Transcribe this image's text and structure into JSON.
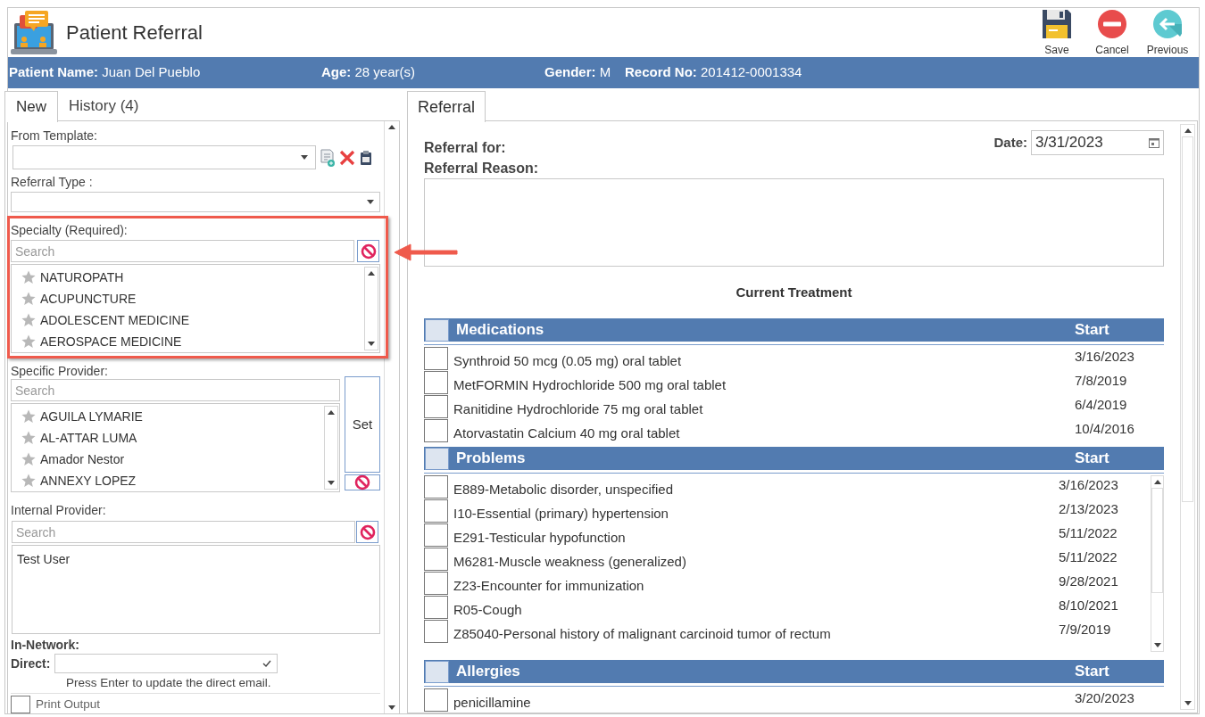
{
  "window": {
    "title": "Patient Referral"
  },
  "toolbar": [
    {
      "kind": "save",
      "label": "Save"
    },
    {
      "kind": "cancel",
      "label": "Cancel"
    },
    {
      "kind": "previous",
      "label": "Previous"
    }
  ],
  "patient_bar": [
    {
      "label": "Patient Name:",
      "value": "Juan Del Pueblo"
    },
    {
      "label": "Age:",
      "value": "28 year(s)"
    },
    {
      "label": "Gender:",
      "value": "M"
    },
    {
      "label": "Record No:",
      "value": "201412-0001334"
    }
  ],
  "left_tabs": [
    {
      "label": "New",
      "selected": true
    },
    {
      "label": "History (4)",
      "selected": false
    }
  ],
  "from_template": {
    "label": "From Template:"
  },
  "referral_type": {
    "label": "Referral Type :"
  },
  "specialty": {
    "label": "Specialty (Required):",
    "placeholder": "Search",
    "items": [
      {
        "name": "NATUROPATH",
        "favorite": false
      },
      {
        "name": "ACUPUNCTURE",
        "favorite": false
      },
      {
        "name": "ADOLESCENT MEDICINE",
        "favorite": false
      },
      {
        "name": "AEROSPACE MEDICINE",
        "favorite": false
      }
    ]
  },
  "specific_provider": {
    "label": "Specific Provider:",
    "placeholder": "Search",
    "set_button": "Set",
    "items": [
      {
        "name": "AGUILA LYMARIE",
        "favorite": false
      },
      {
        "name": "AL-ATTAR LUMA",
        "favorite": false
      },
      {
        "name": "Amador Nestor",
        "favorite": false
      },
      {
        "name": "ANNEXY LOPEZ",
        "favorite": false
      }
    ]
  },
  "internal_provider": {
    "label": "Internal Provider:",
    "placeholder": "Search",
    "value": "Test User"
  },
  "in_network": {
    "label": "In-Network:"
  },
  "direct": {
    "label": "Direct:",
    "hint": "Press Enter to update the direct email."
  },
  "print_output": {
    "label": "Print Output",
    "checked": false
  },
  "right_tabs": [
    {
      "label": "Referral",
      "selected": true
    }
  ],
  "referral": {
    "for_label": "Referral for:",
    "date_label": "Date:",
    "date": "3/31/2023",
    "reason_label": "Referral Reason:",
    "treatment_title": "Current Treatment"
  },
  "sections": [
    {
      "title": "Medications",
      "column": "Start",
      "scroll": false,
      "checked": false,
      "rows": [
        {
          "name": "Synthroid 50 mcg (0.05 mg) oral tablet",
          "start": "3/16/2023",
          "checked": false
        },
        {
          "name": "MetFORMIN Hydrochloride 500 mg oral tablet",
          "start": "7/8/2019",
          "checked": false
        },
        {
          "name": "Ranitidine Hydrochloride 75 mg oral tablet",
          "start": "6/4/2019",
          "checked": false
        },
        {
          "name": "Atorvastatin Calcium 40 mg oral tablet",
          "start": "10/4/2016",
          "checked": false
        }
      ]
    },
    {
      "title": "Problems",
      "column": "Start",
      "scroll": true,
      "checked": false,
      "rows": [
        {
          "name": "E889-Metabolic disorder, unspecified",
          "start": "3/16/2023",
          "checked": false
        },
        {
          "name": "I10-Essential (primary) hypertension",
          "start": "2/13/2023",
          "checked": false
        },
        {
          "name": "E291-Testicular hypofunction",
          "start": "5/11/2022",
          "checked": false
        },
        {
          "name": "M6281-Muscle weakness (generalized)",
          "start": "5/11/2022",
          "checked": false
        },
        {
          "name": "Z23-Encounter for immunization",
          "start": "9/28/2021",
          "checked": false
        },
        {
          "name": "R05-Cough",
          "start": "8/10/2021",
          "checked": false
        },
        {
          "name": "Z85040-Personal history of malignant carcinoid tumor of rectum",
          "start": "7/9/2019",
          "checked": false
        }
      ]
    },
    {
      "title": "Allergies",
      "column": "Start",
      "scroll": false,
      "checked": false,
      "rows": [
        {
          "name": "penicillamine",
          "start": "3/20/2023",
          "checked": false
        }
      ]
    }
  ]
}
